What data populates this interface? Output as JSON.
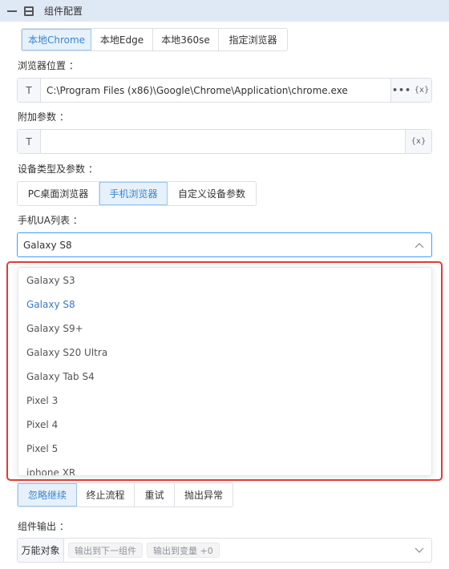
{
  "header": {
    "title": "组件配置"
  },
  "browser_tabs": [
    "本地Chrome",
    "本地Edge",
    "本地360se",
    "指定浏览器"
  ],
  "browser_path": {
    "label": "浏览器位置 ：",
    "prefix": "T",
    "value": "C:\\Program Files (x86)\\Google\\Chrome\\Application\\chrome.exe",
    "dots": "•••",
    "var": "{x}"
  },
  "extra_params": {
    "label": "附加参数 ：",
    "prefix": "T",
    "value": "",
    "var": "{x}"
  },
  "device": {
    "label": "设备类型及参数 ：",
    "tabs": [
      "PC桌面浏览器",
      "手机浏览器",
      "自定义设备参数"
    ]
  },
  "ua": {
    "label": "手机UA列表 ：",
    "selected": "Galaxy S8",
    "options": [
      "Galaxy S3",
      "Galaxy S8",
      "Galaxy S9+",
      "Galaxy S20 Ultra",
      "Galaxy Tab S4",
      "Pixel 3",
      "Pixel 4",
      "Pixel 5",
      "iphone XR"
    ]
  },
  "error_tabs": [
    "忽略继续",
    "终止流程",
    "重试",
    "抛出异常"
  ],
  "output": {
    "label": "组件输出 ：",
    "prefix": "万能对象",
    "tags": [
      "输出到下一组件",
      "输出到变量 +0"
    ]
  },
  "colors": {
    "accent": "#409eff",
    "active_bg": "#e6f1fb",
    "highlight": "#e53935",
    "header_bg": "#dfe8f5"
  }
}
